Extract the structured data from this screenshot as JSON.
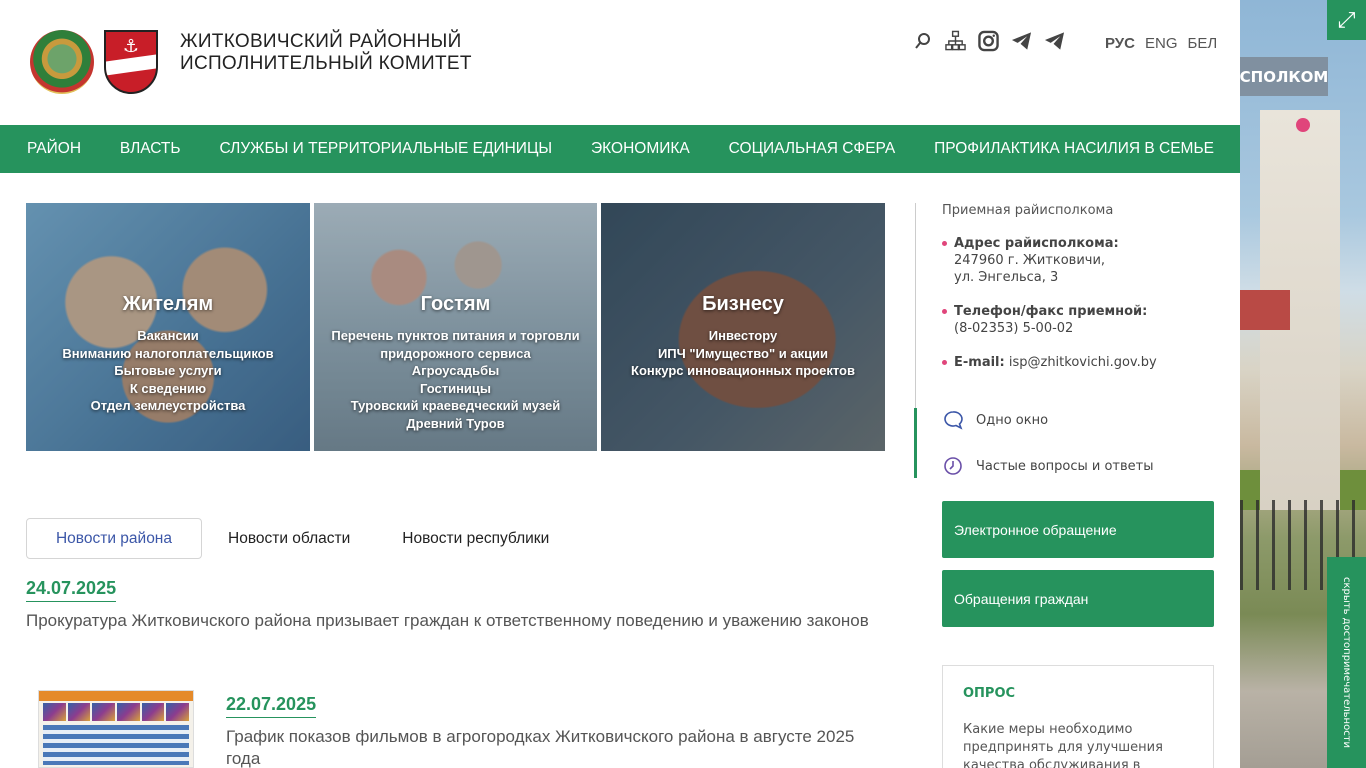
{
  "header": {
    "org_line1": "ЖИТКОВИЧСКИЙ РАЙОННЫЙ",
    "org_line2": "ИСПОЛНИТЕЛЬНЫЙ КОМИТЕТ",
    "languages": [
      "РУС",
      "ENG",
      "БЕЛ"
    ],
    "active_language": "РУС",
    "icons": [
      "search-icon",
      "sitemap-icon",
      "instagram-icon",
      "telegram-icon",
      "telegram-icon"
    ]
  },
  "nav": {
    "items": [
      "РАЙОН",
      "ВЛАСТЬ",
      "СЛУЖБЫ И ТЕРРИТОРИАЛЬНЫЕ ЕДИНИЦЫ",
      "ЭКОНОМИКА",
      "СОЦИАЛЬНАЯ СФЕРА",
      "ПРОФИЛАКТИКА НАСИЛИЯ В СЕМЬЕ"
    ]
  },
  "cards": [
    {
      "title": "Жителям",
      "links": [
        "Вакансии",
        "Вниманию налогоплательщиков",
        "Бытовые услуги",
        "К сведению",
        "Отдел землеустройства"
      ]
    },
    {
      "title": "Гостям",
      "links": [
        "Перечень пунктов питания и торговли",
        "придорожного сервиса",
        "Агроусадьбы",
        "Гостиницы",
        "Туровский краеведческий музей",
        "Древний Туров"
      ]
    },
    {
      "title": "Бизнесу",
      "links": [
        "Инвестору",
        "ИПЧ \"Имущество\" и акции",
        "Конкурс инновационных проектов"
      ]
    }
  ],
  "tabs": [
    "Новости района",
    "Новости области",
    "Новости республики"
  ],
  "news": [
    {
      "date": "24.07.2025",
      "text": "Прокуратура Житковичского района призывает граждан к ответственному поведению и уважению законов"
    },
    {
      "date": "22.07.2025",
      "text": "График показов фильмов в агрогородках Житковичского района в августе 2025 года"
    }
  ],
  "sidebar": {
    "reception_title": "Приемная райисполкома",
    "address_label": "Адрес райисполкома:",
    "address_line1": "247960 г. Житковичи,",
    "address_line2": "ул. Энгельса, 3",
    "phone_label": "Телефон/факс приемной:",
    "phone_value": "(8-02353) 5-00-02",
    "email_label": "E-mail:",
    "email_value": "isp@zhitkovichi.gov.by",
    "link_one_window": "Одно окно",
    "link_faq": "Частые вопросы и ответы",
    "btn_electronic": "Электронное обращение",
    "btn_citizens": "Обращения граждан",
    "poll_title": "ОПРОС",
    "poll_question": "Какие меры необходимо предпринять для улучшения качества обслуживания в службе"
  },
  "right_panel": {
    "ribbon_text": "СПОЛКОМ",
    "side_tab_text": "скрыть достопримечательности"
  },
  "colors": {
    "brand_green": "#26935d",
    "accent_pink": "#e0457b",
    "tab_active_blue": "#3c57a8"
  }
}
